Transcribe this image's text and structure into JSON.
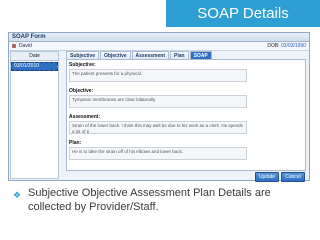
{
  "slide": {
    "title": "SOAP Details",
    "bullet_symbol": "❖",
    "bullet_text": "Subjective Objective Assessment Plan Details are collected by Provider/Staff."
  },
  "app": {
    "window_title": "SOAP Form",
    "patient_name": "David",
    "dob_label": "DOB:",
    "dob_value": "03/03/1990",
    "date_header": "Date",
    "dates": [
      "03/01/2010"
    ],
    "tabs": [
      "Subjective",
      "Objective",
      "Assessment",
      "Plan",
      "SOAP"
    ],
    "active_tab": "SOAP",
    "sections": [
      {
        "label": "Subjective:",
        "text": "The patient presents for a physical."
      },
      {
        "label": "Objective:",
        "text": "Tympanic membranes are clear bilaterally."
      },
      {
        "label": "Assessment:",
        "text": "Strain of the lower back. I think this may well be due to his work as a clerk. He spends a lot of ti"
      },
      {
        "label": "Plan:",
        "text": "He is to take the strain off of his elbows and lower back."
      }
    ],
    "buttons": {
      "update": "Update",
      "cancel": "Cancel"
    }
  },
  "colors": {
    "title_bg": "#2d9fd3",
    "accent": "#2f6fc4",
    "bullet": "#2d9fd3"
  }
}
